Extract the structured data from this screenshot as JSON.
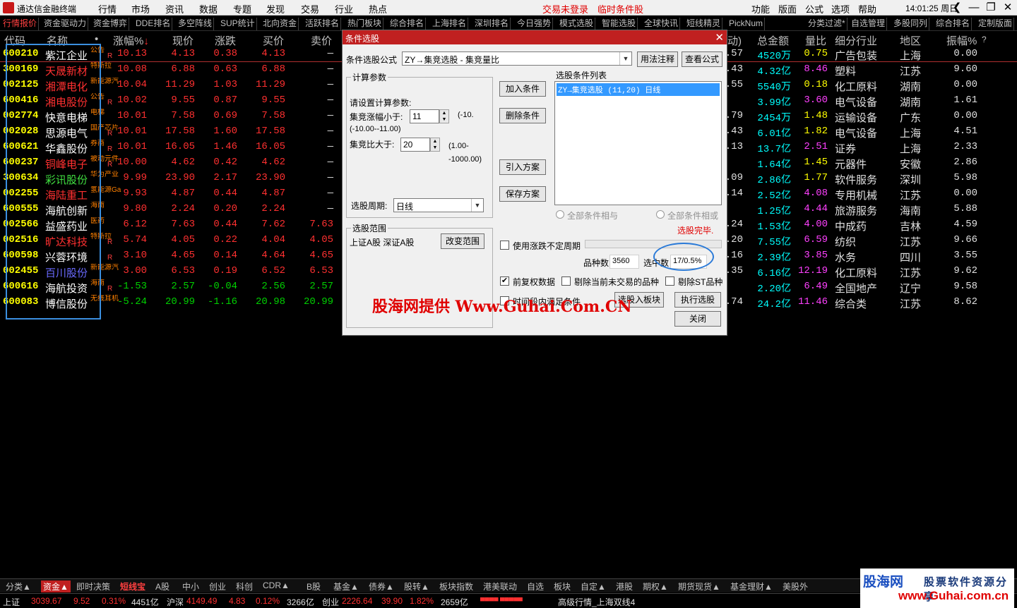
{
  "app_title": "通达信金融终端",
  "menu": [
    "行情",
    "市场",
    "资讯",
    "数据",
    "专题",
    "发现",
    "交易",
    "行业",
    "热点"
  ],
  "menu_red": [
    "交易未登录",
    "临时条件股"
  ],
  "menu_right": [
    "功能",
    "版面",
    "公式",
    "选项",
    "帮助"
  ],
  "clock": "14:01:25",
  "weekday": "周日",
  "tabs_left": [
    "行情报价",
    "资金驱动力",
    "资金博弈",
    "DDE排名",
    "多空阵线",
    "SUP统计",
    "北向资金",
    "活跃排名",
    "热门板块",
    "综合排名",
    "上海排名",
    "深圳排名",
    "今日强势",
    "模式选股",
    "智能选股",
    "全球快讯",
    "短线精灵",
    "PickNum"
  ],
  "tabs_right": [
    "分类过滤*",
    "自选管理",
    "多股同列",
    "综合排名",
    "定制版面"
  ],
  "headers": {
    "code": "代码",
    "name": "名称",
    "dot": "•",
    "chg_pct": "涨幅%",
    "price": "现价",
    "change": "涨跌",
    "bid": "买价",
    "ask": "卖价",
    "turnover_hidden": "动)",
    "amount": "总金额",
    "vol_ratio": "量比",
    "industry": "细分行业",
    "region": "地区",
    "amplitude": "振幅%",
    "q": "?"
  },
  "rows": [
    {
      "code": "600210",
      "name": "紫江企业",
      "name_color": "#ffffff",
      "tag": "公告",
      "rt": "R",
      "chg": "10.13",
      "price": "4.13",
      "change": "0.38",
      "bid": "4.13",
      "ask": "—",
      "hid": ".57",
      "amount": "4520万",
      "vr": "0.75",
      "industry": "广告包装",
      "region": "上海",
      "amp": "0.00",
      "dir": "up"
    },
    {
      "code": "300169",
      "name": "天晟新材",
      "name_color": "#ff3030",
      "tag": "特斯拉",
      "rt": "",
      "chg": "10.08",
      "price": "6.88",
      "change": "0.63",
      "bid": "6.88",
      "ask": "—",
      "hid": ".43",
      "amount": "4.32亿",
      "vr": "8.46",
      "industry": "塑料",
      "region": "江苏",
      "amp": "9.60",
      "dir": "up"
    },
    {
      "code": "002125",
      "name": "湘潭电化",
      "name_color": "#ff3030",
      "tag": "新能源汽",
      "rt": "",
      "chg": "10.04",
      "price": "11.29",
      "change": "1.03",
      "bid": "11.29",
      "ask": "—",
      "hid": ".55",
      "amount": "5540万",
      "vr": "0.18",
      "industry": "化工原料",
      "region": "湖南",
      "amp": "0.00",
      "dir": "up"
    },
    {
      "code": "600416",
      "name": "湘电股份",
      "name_color": "#ff3030",
      "tag": "公告",
      "rt": "R",
      "chg": "10.02",
      "price": "9.55",
      "change": "0.87",
      "bid": "9.55",
      "ask": "—",
      "hid": "",
      "amount": "3.99亿",
      "vr": "3.60",
      "industry": "电气设备",
      "region": "湖南",
      "amp": "1.61",
      "dir": "up"
    },
    {
      "code": "002774",
      "name": "快意电梯",
      "name_color": "#ffffff",
      "tag": "电梯",
      "rt": "",
      "chg": "10.01",
      "price": "7.58",
      "change": "0.69",
      "bid": "7.58",
      "ask": "—",
      "hid": ".79",
      "amount": "2454万",
      "vr": "1.48",
      "industry": "运输设备",
      "region": "广东",
      "amp": "0.00",
      "dir": "up"
    },
    {
      "code": "002028",
      "name": "思源电气",
      "name_color": "#ffffff",
      "tag": "国产芯片",
      "rt": "R",
      "chg": "10.01",
      "price": "17.58",
      "change": "1.60",
      "bid": "17.58",
      "ask": "—",
      "hid": ".43",
      "amount": "6.01亿",
      "vr": "1.82",
      "industry": "电气设备",
      "region": "上海",
      "amp": "4.51",
      "dir": "up"
    },
    {
      "code": "600621",
      "name": "华鑫股份",
      "name_color": "#ffffff",
      "tag": "券商",
      "rt": "R",
      "chg": "10.01",
      "price": "16.05",
      "change": "1.46",
      "bid": "16.05",
      "ask": "—",
      "hid": ".13",
      "amount": "13.7亿",
      "vr": "2.51",
      "industry": "证券",
      "region": "上海",
      "amp": "2.33",
      "dir": "up"
    },
    {
      "code": "600237",
      "name": "铜峰电子",
      "name_color": "#ff3030",
      "tag": "被动元件",
      "rt": "R",
      "chg": "10.00",
      "price": "4.62",
      "change": "0.42",
      "bid": "4.62",
      "ask": "—",
      "hid": "",
      "amount": "1.64亿",
      "vr": "1.45",
      "industry": "元器件",
      "region": "安徽",
      "amp": "2.86",
      "dir": "up"
    },
    {
      "code": "300634",
      "name": "彩讯股份",
      "name_color": "#40e040",
      "tag": "华为产业",
      "rt": "",
      "chg": "9.99",
      "price": "23.90",
      "change": "2.17",
      "bid": "23.90",
      "ask": "—",
      "hid": ".09",
      "amount": "2.86亿",
      "vr": "1.77",
      "industry": "软件服务",
      "region": "深圳",
      "amp": "5.98",
      "dir": "up"
    },
    {
      "code": "002255",
      "name": "海陆重工",
      "name_color": "#ff3030",
      "tag": "氢能源Ga",
      "rt": "",
      "chg": "9.93",
      "price": "4.87",
      "change": "0.44",
      "bid": "4.87",
      "ask": "—",
      "hid": ".14",
      "amount": "2.52亿",
      "vr": "4.08",
      "industry": "专用机械",
      "region": "江苏",
      "amp": "0.00",
      "dir": "up"
    },
    {
      "code": "600555",
      "name": "海航创新",
      "name_color": "#ffffff",
      "tag": "海南",
      "rt": "",
      "chg": "9.80",
      "price": "2.24",
      "change": "0.20",
      "bid": "2.24",
      "ask": "—",
      "hid": "",
      "amount": "1.25亿",
      "vr": "4.44",
      "industry": "旅游服务",
      "region": "海南",
      "amp": "5.88",
      "dir": "up"
    },
    {
      "code": "002566",
      "name": "益盛药业",
      "name_color": "#ffffff",
      "tag": "医药",
      "rt": "",
      "chg": "6.12",
      "price": "7.63",
      "change": "0.44",
      "bid": "7.62",
      "ask": "7.63",
      "hid": ".24",
      "amount": "1.53亿",
      "vr": "4.00",
      "industry": "中成药",
      "region": "吉林",
      "amp": "4.59",
      "dir": "up"
    },
    {
      "code": "002516",
      "name": "旷达科技",
      "name_color": "#ff3030",
      "tag": "特斯拉",
      "rt": "R",
      "chg": "5.74",
      "price": "4.05",
      "change": "0.22",
      "bid": "4.04",
      "ask": "4.05",
      "hid": ".20",
      "amount": "7.55亿",
      "vr": "6.59",
      "industry": "纺织",
      "region": "江苏",
      "amp": "9.66",
      "dir": "up"
    },
    {
      "code": "600598",
      "name": "兴蓉环境",
      "name_color": "#ffffff",
      "tag": "",
      "rt": "R",
      "chg": "3.10",
      "price": "4.65",
      "change": "0.14",
      "bid": "4.64",
      "ask": "4.65",
      "hid": ".16",
      "amount": "2.39亿",
      "vr": "3.85",
      "industry": "水务",
      "region": "四川",
      "amp": "3.55",
      "dir": "up"
    },
    {
      "code": "002455",
      "name": "百川股份",
      "name_color": "#6a6aff",
      "tag": "新能源汽",
      "rt": "",
      "chg": "3.00",
      "price": "6.53",
      "change": "0.19",
      "bid": "6.52",
      "ask": "6.53",
      "hid": ".35",
      "amount": "6.16亿",
      "vr": "12.19",
      "industry": "化工原料",
      "region": "江苏",
      "amp": "9.62",
      "dir": "up"
    },
    {
      "code": "600616",
      "name": "海航投资",
      "name_color": "#ffffff",
      "tag": "海南",
      "rt": "R",
      "chg": "-1.53",
      "price": "2.57",
      "change": "-0.04",
      "bid": "2.56",
      "ask": "2.57",
      "hid": "",
      "amount": "2.20亿",
      "vr": "6.49",
      "industry": "全国地产",
      "region": "辽宁",
      "amp": "9.58",
      "dir": "dn"
    },
    {
      "code": "600083",
      "name": "博信股份",
      "name_color": "#ffffff",
      "tag": "无线耳机",
      "rt": "",
      "chg": "-5.24",
      "price": "20.99",
      "change": "-1.16",
      "bid": "20.98",
      "ask": "20.99",
      "hid": ".74",
      "amount": "24.2亿",
      "vr": "11.46",
      "industry": "综合类",
      "region": "江苏",
      "amp": "8.62",
      "dir": "dn"
    }
  ],
  "dialog": {
    "title": "条件选股",
    "formula_label": "条件选股公式",
    "formula_value": "ZY→集竞选股 - 集竞量比",
    "btn_usage": "用法注释",
    "btn_view": "查看公式",
    "params_group": "计算参数",
    "params_hint": "请设置计算参数:",
    "p1_label": "集竞涨幅小于:",
    "p1_value": "11",
    "p1_range": "(-10.00--11.00)",
    "p2_label": "集竞比大于:",
    "p2_value": "20",
    "p2_range": "(1.00--1000.00)",
    "period_label": "选股周期:",
    "period_value": "日线",
    "btn_add": "加入条件",
    "btn_delete": "删除条件",
    "btn_import": "引入方案",
    "btn_save": "保存方案",
    "list_label": "选股条件列表",
    "list_item": "ZY→集竞选股 (11,20) 日线",
    "radio_and": "全部条件相与",
    "radio_or": "全部条件相或",
    "done_text": "选股完毕.",
    "range_group": "选股范围",
    "range_value": "上证A股 深证A股",
    "btn_change_range": "改变范围",
    "chk_uncertain": "使用涨跌不定周期",
    "count_label": "品种数",
    "count_value": "3560",
    "selected_label": "选中数",
    "selected_value": "17/0.5%",
    "chk_forward": "前复权数据",
    "chk_exclude_untraded": "剔除当前未交易的品种",
    "chk_exclude_st": "剔除ST品种",
    "chk_time_range": "时间段内满足条件",
    "btn_to_block": "选股入板块",
    "btn_execute": "执行选股",
    "btn_close": "关闭"
  },
  "watermark": "股海网提供 Www.Guhai.Com.CN",
  "bottom_tabs": [
    "分类▲",
    "资金▲",
    "即时决策",
    "短线宝",
    "A股",
    "中小",
    "创业",
    "科创",
    "CDR▲",
    "B股",
    "基金▲",
    "债券▲",
    "股转▲",
    "板块指数",
    "港美联动",
    "自选",
    "板块",
    "自定▲",
    "港股",
    "期权▲",
    "期货现货▲",
    "基金理财▲",
    "美股外"
  ],
  "status": {
    "sh_label": "上证",
    "sh_value": "3039.67",
    "sh_chg": "9.52",
    "sh_pct": "0.31%",
    "sh_amt": "4451亿",
    "hs_label": "沪深",
    "hs_value": "4149.49",
    "hs_chg": "4.83",
    "hs_pct": "0.12%",
    "hs_amt": "3266亿",
    "cy_label": "创业",
    "cy_value": "2226.64",
    "cy_chg": "39.90",
    "cy_pct": "1.82%",
    "cy_amt": "2659亿",
    "server": "高级行情_上海双线4"
  },
  "brand": {
    "name": "股海网",
    "slogan": "股票软件资源分享",
    "url": "www.Guhai.com.cn"
  }
}
